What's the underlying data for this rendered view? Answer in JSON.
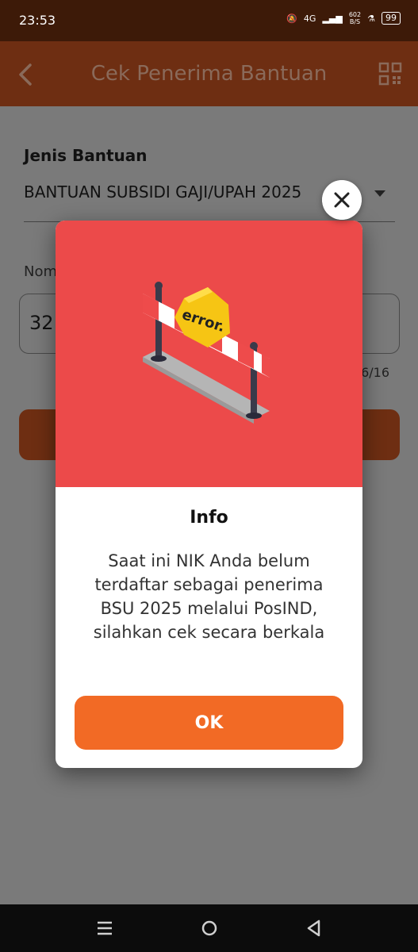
{
  "status_bar": {
    "time": "23:53",
    "network": "4G",
    "speed": "602\nB/S",
    "battery": "99"
  },
  "app_bar": {
    "title": "Cek Penerima Bantuan",
    "back_icon": "chevron-left-icon",
    "qr_icon": "qr-code-icon"
  },
  "form": {
    "jenis_label": "Jenis Bantuan",
    "jenis_value": "BANTUAN SUBSIDI GAJI/UPAH 2025",
    "nomor_label": "Nom",
    "nomor_value": "32",
    "counter": "16/16"
  },
  "dialog": {
    "title": "Info",
    "message": "Saat ini NIK Anda belum terdaftar sebagai penerima BSU 2025 melalui PosIND, silahkan cek secara berkala",
    "ok_label": "OK",
    "error_sign_text": "error.",
    "hero_bg": "#ec4a4a",
    "ok_color": "#f26a25"
  },
  "colors": {
    "app_bar": "#6e2e12",
    "status_bar": "#3d1a08"
  }
}
